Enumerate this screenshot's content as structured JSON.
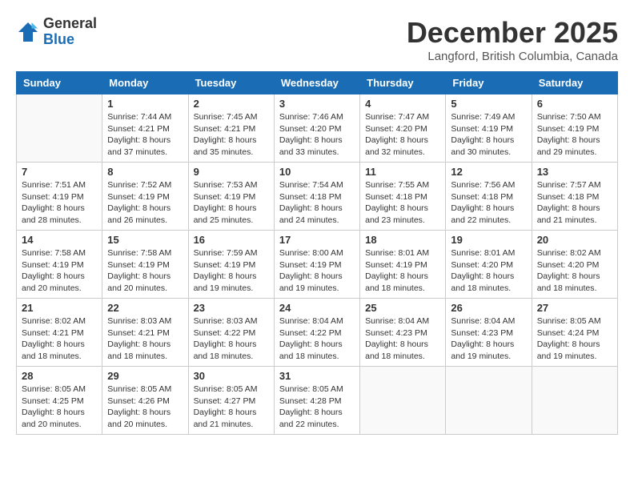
{
  "logo": {
    "general": "General",
    "blue": "Blue"
  },
  "title": "December 2025",
  "location": "Langford, British Columbia, Canada",
  "weekdays": [
    "Sunday",
    "Monday",
    "Tuesday",
    "Wednesday",
    "Thursday",
    "Friday",
    "Saturday"
  ],
  "weeks": [
    [
      {
        "day": "",
        "info": ""
      },
      {
        "day": "1",
        "info": "Sunrise: 7:44 AM\nSunset: 4:21 PM\nDaylight: 8 hours\nand 37 minutes."
      },
      {
        "day": "2",
        "info": "Sunrise: 7:45 AM\nSunset: 4:21 PM\nDaylight: 8 hours\nand 35 minutes."
      },
      {
        "day": "3",
        "info": "Sunrise: 7:46 AM\nSunset: 4:20 PM\nDaylight: 8 hours\nand 33 minutes."
      },
      {
        "day": "4",
        "info": "Sunrise: 7:47 AM\nSunset: 4:20 PM\nDaylight: 8 hours\nand 32 minutes."
      },
      {
        "day": "5",
        "info": "Sunrise: 7:49 AM\nSunset: 4:19 PM\nDaylight: 8 hours\nand 30 minutes."
      },
      {
        "day": "6",
        "info": "Sunrise: 7:50 AM\nSunset: 4:19 PM\nDaylight: 8 hours\nand 29 minutes."
      }
    ],
    [
      {
        "day": "7",
        "info": "Sunrise: 7:51 AM\nSunset: 4:19 PM\nDaylight: 8 hours\nand 28 minutes."
      },
      {
        "day": "8",
        "info": "Sunrise: 7:52 AM\nSunset: 4:19 PM\nDaylight: 8 hours\nand 26 minutes."
      },
      {
        "day": "9",
        "info": "Sunrise: 7:53 AM\nSunset: 4:19 PM\nDaylight: 8 hours\nand 25 minutes."
      },
      {
        "day": "10",
        "info": "Sunrise: 7:54 AM\nSunset: 4:18 PM\nDaylight: 8 hours\nand 24 minutes."
      },
      {
        "day": "11",
        "info": "Sunrise: 7:55 AM\nSunset: 4:18 PM\nDaylight: 8 hours\nand 23 minutes."
      },
      {
        "day": "12",
        "info": "Sunrise: 7:56 AM\nSunset: 4:18 PM\nDaylight: 8 hours\nand 22 minutes."
      },
      {
        "day": "13",
        "info": "Sunrise: 7:57 AM\nSunset: 4:18 PM\nDaylight: 8 hours\nand 21 minutes."
      }
    ],
    [
      {
        "day": "14",
        "info": "Sunrise: 7:58 AM\nSunset: 4:19 PM\nDaylight: 8 hours\nand 20 minutes."
      },
      {
        "day": "15",
        "info": "Sunrise: 7:58 AM\nSunset: 4:19 PM\nDaylight: 8 hours\nand 20 minutes."
      },
      {
        "day": "16",
        "info": "Sunrise: 7:59 AM\nSunset: 4:19 PM\nDaylight: 8 hours\nand 19 minutes."
      },
      {
        "day": "17",
        "info": "Sunrise: 8:00 AM\nSunset: 4:19 PM\nDaylight: 8 hours\nand 19 minutes."
      },
      {
        "day": "18",
        "info": "Sunrise: 8:01 AM\nSunset: 4:19 PM\nDaylight: 8 hours\nand 18 minutes."
      },
      {
        "day": "19",
        "info": "Sunrise: 8:01 AM\nSunset: 4:20 PM\nDaylight: 8 hours\nand 18 minutes."
      },
      {
        "day": "20",
        "info": "Sunrise: 8:02 AM\nSunset: 4:20 PM\nDaylight: 8 hours\nand 18 minutes."
      }
    ],
    [
      {
        "day": "21",
        "info": "Sunrise: 8:02 AM\nSunset: 4:21 PM\nDaylight: 8 hours\nand 18 minutes."
      },
      {
        "day": "22",
        "info": "Sunrise: 8:03 AM\nSunset: 4:21 PM\nDaylight: 8 hours\nand 18 minutes."
      },
      {
        "day": "23",
        "info": "Sunrise: 8:03 AM\nSunset: 4:22 PM\nDaylight: 8 hours\nand 18 minutes."
      },
      {
        "day": "24",
        "info": "Sunrise: 8:04 AM\nSunset: 4:22 PM\nDaylight: 8 hours\nand 18 minutes."
      },
      {
        "day": "25",
        "info": "Sunrise: 8:04 AM\nSunset: 4:23 PM\nDaylight: 8 hours\nand 18 minutes."
      },
      {
        "day": "26",
        "info": "Sunrise: 8:04 AM\nSunset: 4:23 PM\nDaylight: 8 hours\nand 19 minutes."
      },
      {
        "day": "27",
        "info": "Sunrise: 8:05 AM\nSunset: 4:24 PM\nDaylight: 8 hours\nand 19 minutes."
      }
    ],
    [
      {
        "day": "28",
        "info": "Sunrise: 8:05 AM\nSunset: 4:25 PM\nDaylight: 8 hours\nand 20 minutes."
      },
      {
        "day": "29",
        "info": "Sunrise: 8:05 AM\nSunset: 4:26 PM\nDaylight: 8 hours\nand 20 minutes."
      },
      {
        "day": "30",
        "info": "Sunrise: 8:05 AM\nSunset: 4:27 PM\nDaylight: 8 hours\nand 21 minutes."
      },
      {
        "day": "31",
        "info": "Sunrise: 8:05 AM\nSunset: 4:28 PM\nDaylight: 8 hours\nand 22 minutes."
      },
      {
        "day": "",
        "info": ""
      },
      {
        "day": "",
        "info": ""
      },
      {
        "day": "",
        "info": ""
      }
    ]
  ]
}
